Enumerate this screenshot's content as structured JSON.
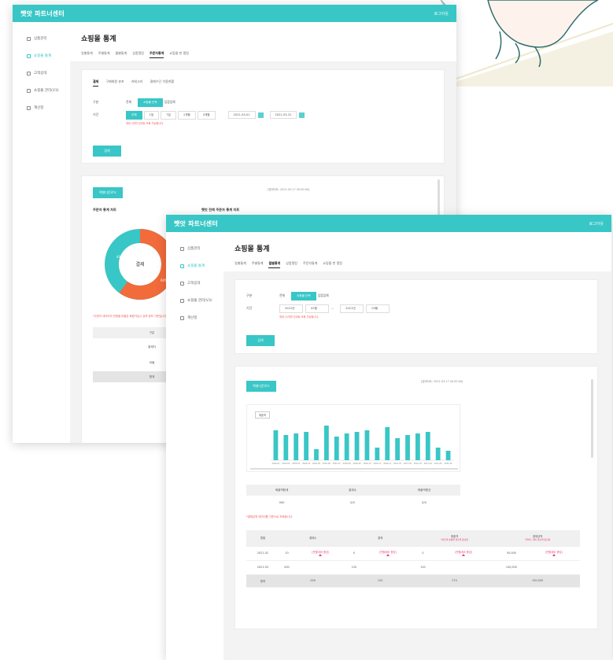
{
  "brand": "쨋앗 파트너센터",
  "logout": "로그아웃",
  "sidebar": [
    {
      "label": "상품관리",
      "icon": "box-icon",
      "active": false
    },
    {
      "label": "쇼핑몰 통계",
      "icon": "chart-icon",
      "active": true
    },
    {
      "label": "고객응대",
      "icon": "chat-icon",
      "active": false
    },
    {
      "label": "쇼핑몰 관리(V3)",
      "icon": "settings-icon",
      "active": false
    },
    {
      "label": "계산정",
      "icon": "calc-icon",
      "active": false
    }
  ],
  "page_title": "쇼핑몰 통계",
  "win1": {
    "tabs": [
      "일별통계",
      "주별통계",
      "월별통계",
      "상품랭킹",
      "주문자통계",
      "쇼핑몰 펀 랭킹"
    ],
    "active_tab": 4,
    "subtabs": [
      "결제",
      "구매회원 분포",
      "카테고리",
      "결제수단 이용현황"
    ],
    "filter_label": "구분",
    "filter_options": [
      "전체",
      "쇼핑몰 단독",
      "입점업체"
    ],
    "period_label": "기간",
    "period_options": [
      "전체",
      "1일",
      "7일",
      "1개월",
      "3개월"
    ],
    "date_from": "2021-03-01",
    "date_to": "2021-03-31",
    "hint": "최대 3개월 단위로 조회 가능합니다.",
    "search": "검색",
    "excel": "엑셀다운로드",
    "updated": "[업데이트: 2021-03-17 00:00:00]",
    "chart_title": "주문자 통계 차트",
    "chart_title_2": "쨋앗 전체 주문자 통계 차트",
    "donut_center": "결제",
    "donut_labels": [
      "40%",
      "60%"
    ],
    "note": "*주문자 데이터의 연령별 비율은 회원가입시 입력 정보 기준입니다.",
    "table_rows": [
      "구분",
      "결제자",
      "비율",
      "합계"
    ]
  },
  "win2": {
    "tabs": [
      "일별통계",
      "주별통계",
      "월별통계",
      "상품랭킹",
      "주문자통계",
      "쇼핑몰 펀 랭킹"
    ],
    "active_tab": 2,
    "filter_label": "구분",
    "filter_options": [
      "전체",
      "쇼핑몰 단독",
      "입점업체"
    ],
    "period_label": "기간",
    "year_from": "2021년",
    "month_from": "02월",
    "year_to": "2021년",
    "month_to": "03월",
    "hint": "최대 12개월 단위로 조회 가능합니다.",
    "search": "검색",
    "excel": "엑셀다운로드",
    "updated": "[업데이트: 2021-03-17 00:00:00]",
    "chart_legend": "매출액",
    "summary_headers": [
      "매출액합계",
      "결제수",
      "매출액평균"
    ],
    "summary_values": [
      "000",
      "0/0",
      "0/0"
    ],
    "summary_note": "*결제금액 데이터를 기준으로 조회됩니다.",
    "table_headers": [
      "월별",
      "결제수",
      "결제",
      "매출액",
      "결제금액"
    ],
    "table_subheaders": [
      "",
      "",
      "",
      "*매출액 상품별 매출액 증감률",
      "*결제수 대비 매출액 증감률"
    ],
    "rows": [
      {
        "month": "2021-02",
        "a": "10",
        "tag_a": "(전월대비 증감)",
        "b": "0",
        "tag_b": "(전월대비 증감)",
        "c": "0",
        "tag_c": "(전월대비 증감)",
        "d": "50,000",
        "tag_d": "(전월대비 증감)"
      },
      {
        "month": "2021-03",
        "a": "000",
        "tag_a": "",
        "b": "120",
        "tag_b": "",
        "c": "120",
        "tag_c": "",
        "d": "100,000",
        "tag_d": ""
      }
    ],
    "total_row": {
      "month": "합계",
      "a": "000",
      "b": "120",
      "c": "270",
      "d": "150,000"
    }
  },
  "chart_data": {
    "type": "bar",
    "title": "",
    "categories": [
      "2020-01",
      "2020-02",
      "2020-03",
      "2020-04",
      "2020-05",
      "2020-06",
      "2020-07",
      "2020-08",
      "2020-09",
      "2020-10",
      "2020-11",
      "2020-12",
      "2021-01",
      "2021-02",
      "2021-03",
      "2021-04",
      "2021-05",
      "2021-06"
    ],
    "series": [
      {
        "name": "매출액",
        "values": [
          95,
          80,
          85,
          90,
          35,
          110,
          75,
          85,
          90,
          95,
          40,
          105,
          70,
          80,
          85,
          90,
          40,
          30
        ]
      }
    ],
    "ylim": [
      0,
      120
    ],
    "xlabel": "",
    "ylabel": ""
  },
  "donut": {
    "values": [
      60,
      40
    ],
    "colors": [
      "#f26b3a",
      "#39c6c6"
    ]
  },
  "accent": "#39c6c6"
}
